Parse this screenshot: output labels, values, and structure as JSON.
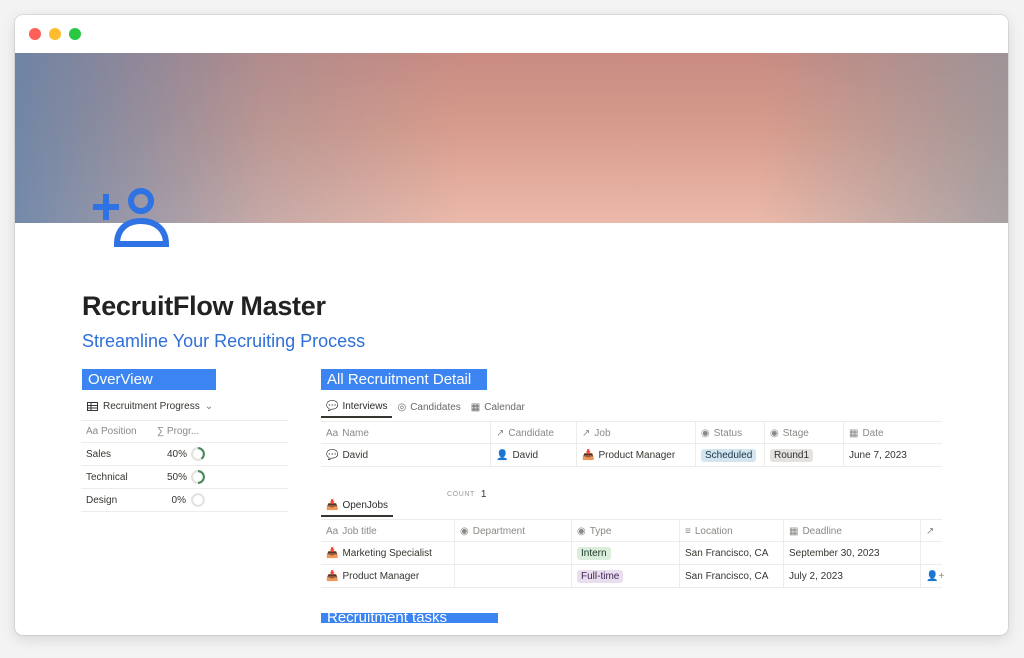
{
  "page": {
    "title": "RecruitFlow Master",
    "subtitle": "Streamline Your Recruiting Process"
  },
  "overview": {
    "heading": "OverView",
    "view_label": "Recruitment Progress",
    "columns": [
      "Position",
      "Progr..."
    ],
    "rows": [
      {
        "position": "Sales",
        "progress": "40%",
        "value": 0.4
      },
      {
        "position": "Technical",
        "progress": "50%",
        "value": 0.5
      },
      {
        "position": "Design",
        "progress": "0%",
        "value": 0.0
      }
    ]
  },
  "detail": {
    "heading": "All Recruitment Detail",
    "tabs": [
      {
        "label": "Interviews",
        "active": true
      },
      {
        "label": "Candidates",
        "active": false
      },
      {
        "label": "Calendar",
        "active": false
      }
    ],
    "interviews": {
      "columns": [
        "Name",
        "Candidate",
        "Job",
        "Status",
        "Stage",
        "Date"
      ],
      "rows": [
        {
          "name": "David",
          "candidate": "David",
          "job": "Product Manager",
          "status": "Scheduled",
          "stage": "Round1",
          "date": "June 7, 2023"
        }
      ],
      "count_label": "COUNT",
      "count": "1"
    },
    "openjobs_tab": "OpenJobs",
    "openjobs": {
      "columns": [
        "Job title",
        "Department",
        "Type",
        "Location",
        "Deadline"
      ],
      "rows": [
        {
          "title": "Marketing Specialist",
          "department": "",
          "type": "Intern",
          "location": "San Francisco, CA",
          "deadline": "September 30, 2023"
        },
        {
          "title": "Product Manager",
          "department": "",
          "type": "Full-time",
          "location": "San Francisco, CA",
          "deadline": "July 2, 2023"
        }
      ]
    }
  },
  "tasks_heading": "Recruitment tasks",
  "colors": {
    "accent": "#3c84f2",
    "subtitle": "#2e6fd8",
    "progress_ring": "#4a8a5e"
  }
}
